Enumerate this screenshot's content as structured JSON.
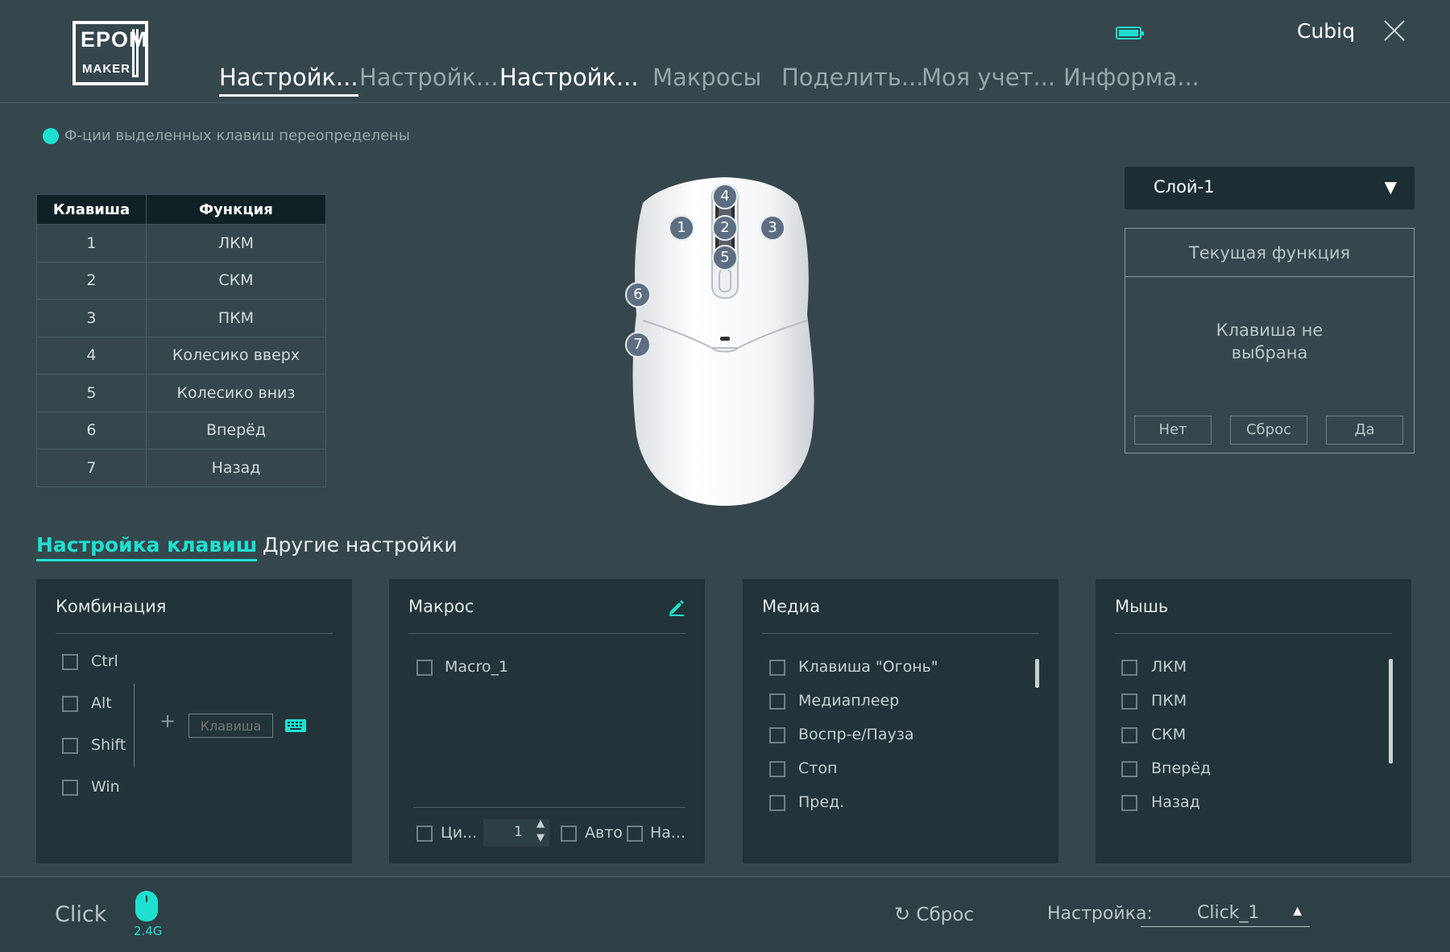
{
  "brand": {
    "logo_line1": "EPOM",
    "logo_line2": "MAKER"
  },
  "nav": {
    "tabs": [
      {
        "label": "Настройк..."
      },
      {
        "label": "Настройк..."
      },
      {
        "label": "Настройк..."
      },
      {
        "label": "Макросы"
      },
      {
        "label": "Поделить..."
      },
      {
        "label": "Моя учет..."
      },
      {
        "label": "Информа..."
      }
    ]
  },
  "header": {
    "profile_name": "Cubiq",
    "accent_color": "#1fe0d0"
  },
  "notice": {
    "text": "Ф-ции выделенных клавиш переопределены"
  },
  "key_table": {
    "headers": [
      "Клавиша",
      "Функция"
    ],
    "rows": [
      [
        "1",
        "ЛКМ"
      ],
      [
        "2",
        "СКМ"
      ],
      [
        "3",
        "ПКМ"
      ],
      [
        "4",
        "Колесико вверх"
      ],
      [
        "5",
        "Колесико вниз"
      ],
      [
        "6",
        "Вперёд"
      ],
      [
        "7",
        "Назад"
      ]
    ]
  },
  "mouse_badges": [
    "1",
    "2",
    "3",
    "4",
    "5",
    "6",
    "7"
  ],
  "layer": {
    "selected": "Слой-1"
  },
  "current_function": {
    "title": "Текущая функция",
    "message_line1": "Клавиша не",
    "message_line2": "выбрана",
    "buttons": [
      "Нет",
      "Сброс",
      "Да"
    ]
  },
  "subtabs": [
    "Настройка клавиш",
    "Другие настройки"
  ],
  "combo": {
    "title": "Комбинация",
    "modifiers": [
      "Ctrl",
      "Alt",
      "Shift",
      "Win"
    ],
    "plus": "+",
    "key_placeholder": "Клавиша"
  },
  "macro": {
    "title": "Макрос",
    "items": [
      "Macro_1"
    ],
    "cycle_label": "Ци...",
    "count_value": "1",
    "auto_label": "Авто",
    "na_label": "На..."
  },
  "media": {
    "title": "Медиа",
    "items": [
      "Клавиша \"Огонь\"",
      "Медиаплеер",
      "Воспр-е/Пауза",
      "Стоп",
      "Пред."
    ]
  },
  "mouse_panel": {
    "title": "Мышь",
    "items": [
      "ЛКМ",
      "ПКМ",
      "СКМ",
      "Вперёд",
      "Назад"
    ]
  },
  "footer": {
    "mode": "Click",
    "connection": "2.4G",
    "reset": "Сброс",
    "profile_label": "Настройка:",
    "profile_value": "Click_1"
  }
}
